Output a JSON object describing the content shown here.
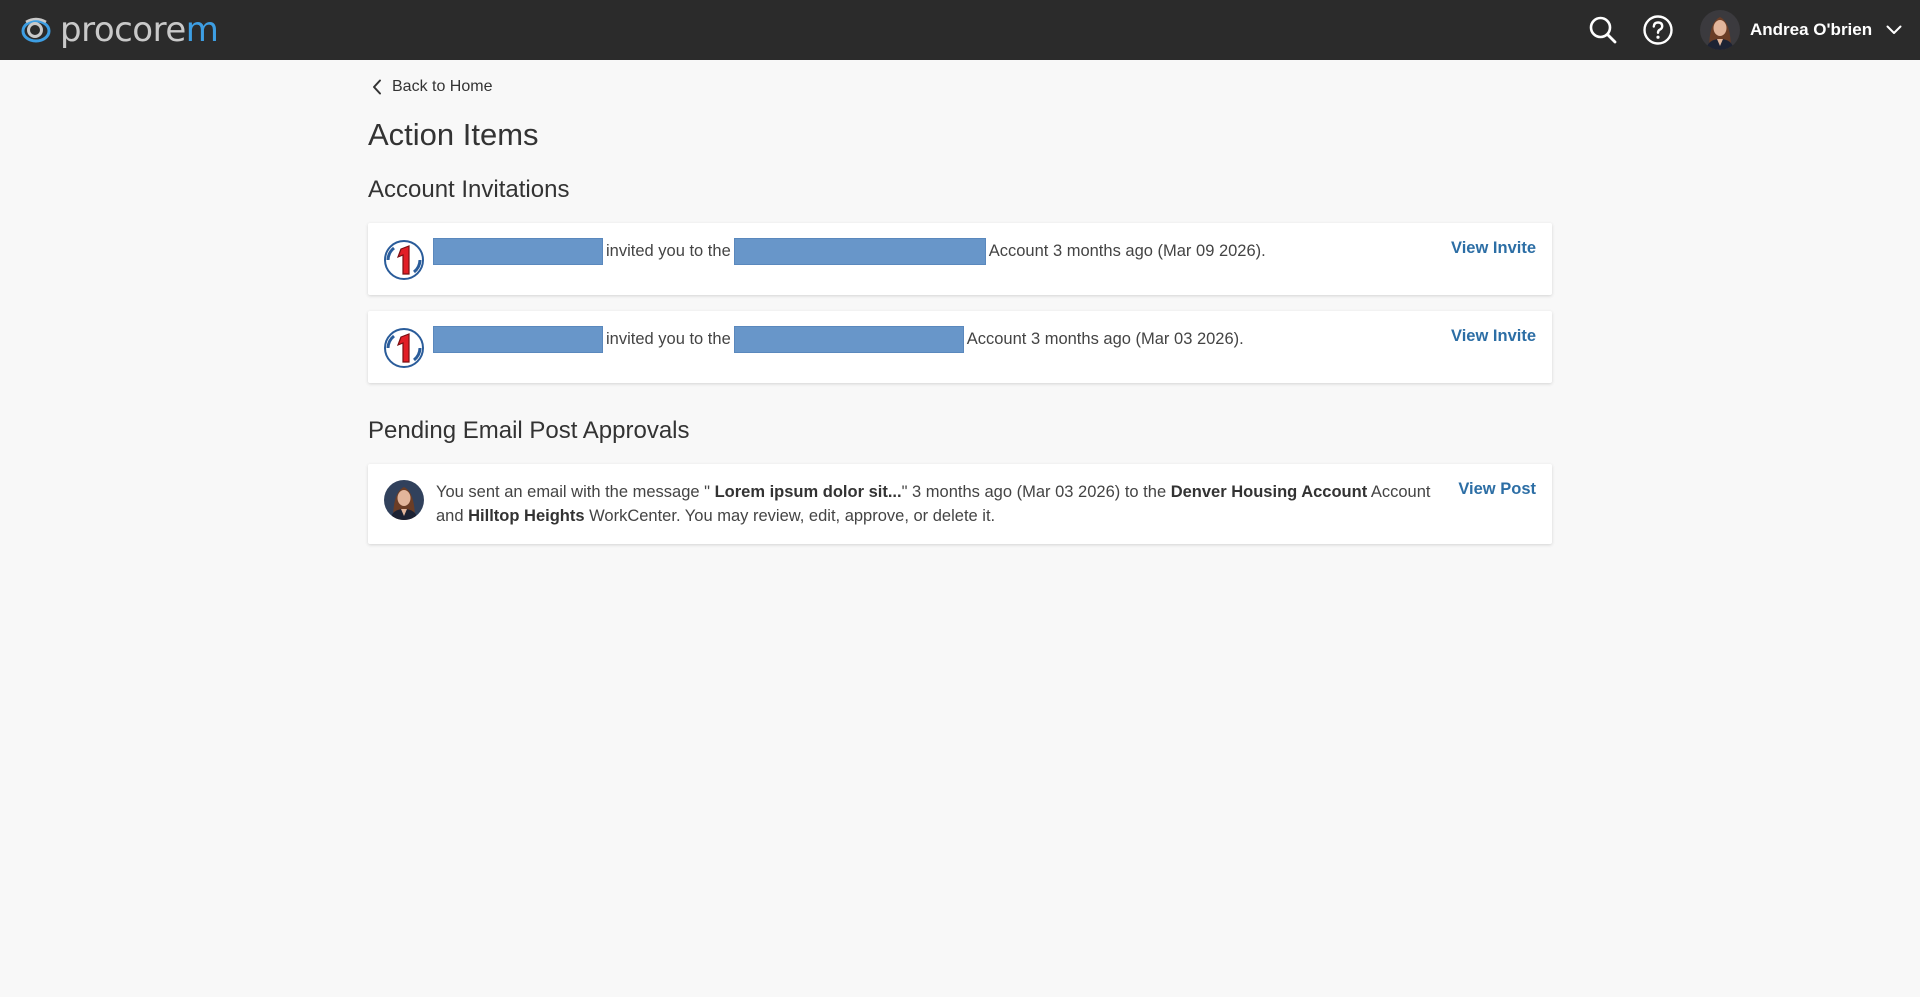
{
  "app": {
    "logo_text_main": "procore",
    "logo_text_accent": "m"
  },
  "header": {
    "search_icon": "search-icon",
    "help_icon": "help-icon",
    "user_name": "Andrea O'brien"
  },
  "nav": {
    "back_label": "Back to Home"
  },
  "page": {
    "title": "Action Items"
  },
  "invitations": {
    "section_title": "Account Invitations",
    "items": [
      {
        "invited_text": "invited you to the",
        "suffix": "Account 3 months ago (Mar 09 2026).",
        "action_label": "View Invite"
      },
      {
        "invited_text": "invited you to the",
        "suffix": "Account 3 months ago (Mar 03 2026).",
        "action_label": "View Invite"
      }
    ]
  },
  "approvals": {
    "section_title": "Pending Email Post Approvals",
    "items": [
      {
        "part1": "You sent an email with the message \" ",
        "message": "Lorem ipsum dolor sit...",
        "part2": "\" 3 months ago (Mar 03 2026) to the ",
        "account_name": "Denver Housing Account",
        "part3": " Account and ",
        "workcenter_name": "Hilltop Heights",
        "part4": " WorkCenter. You may review, edit, approve, or delete it.",
        "action_label": "View Post"
      }
    ]
  },
  "colors": {
    "topbar": "#2b2b2b",
    "link": "#2c6ea5",
    "redaction": "#6896c9",
    "background": "#f8f8f8"
  }
}
